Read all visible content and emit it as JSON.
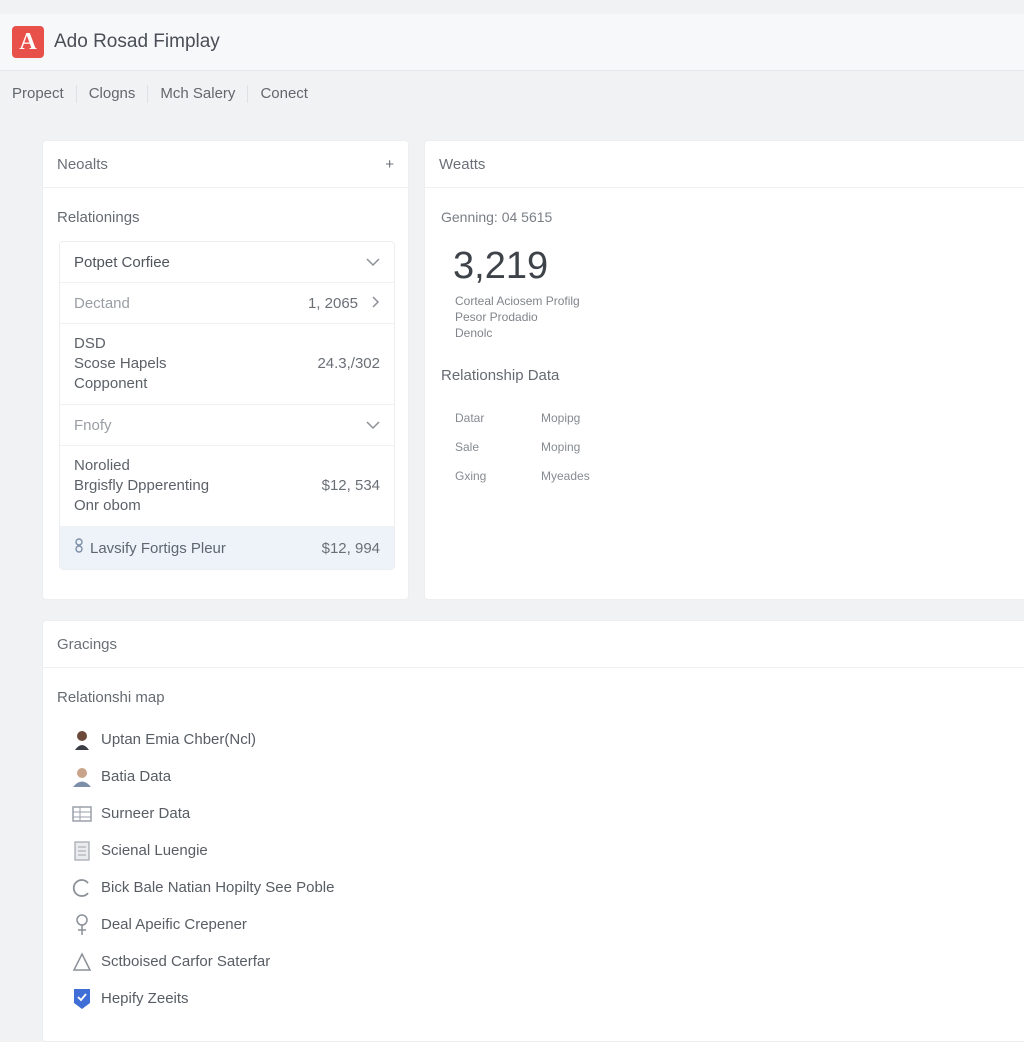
{
  "app": {
    "title": "Ado Rosad Fimplay",
    "logo_letter": "A"
  },
  "menu": [
    "Propect",
    "Clogns",
    "Mch Salery",
    "Conect"
  ],
  "left_panel": {
    "header": "Neoalts",
    "add_symbol": "+",
    "section_title": "Relationings",
    "select_value": "Potpet Corfiee",
    "rows": [
      {
        "label": "Dectand",
        "value": "1, 2065"
      },
      {
        "label_lines": [
          "DSD",
          "Scose Hapels",
          "Copponent"
        ],
        "value": "24.3,/302"
      },
      {
        "label": "Fnofy"
      },
      {
        "label_lines": [
          "Norolied",
          "Brgisfly Dpperenting",
          "Onr obom"
        ],
        "value": "$12, 534"
      },
      {
        "label": "Lavsify Fortigs Pleur",
        "value": "$12, 994"
      }
    ]
  },
  "right_panel": {
    "header": "Weatts",
    "gain_label": "Genning: 04 5615",
    "big_number": "3,219",
    "desc_lines": [
      "Corteal Aciosem Profilg",
      "Pesor Prodadio",
      "Denolc"
    ],
    "relationship_title": "Relationship Data",
    "table": [
      {
        "a": "Datar",
        "b": "Mopipg"
      },
      {
        "a": "Sale",
        "b": "Moping"
      },
      {
        "a": "Gxing",
        "b": "Myeades"
      }
    ]
  },
  "bottom_panel": {
    "header": "Gracings",
    "section_title": "Relationshi map",
    "items": [
      {
        "icon": "person-icon",
        "label": "Uptan Emia Chber(Ncl)"
      },
      {
        "icon": "user-icon",
        "label": "Batia Data"
      },
      {
        "icon": "grid-icon",
        "label": "Surneer Data"
      },
      {
        "icon": "document-icon",
        "label": "Scienal Luengie"
      },
      {
        "icon": "refresh-icon",
        "label": "Bick Bale Natian Hopilty See Poble"
      },
      {
        "icon": "pin-icon",
        "label": "Deal Apeific Crepener"
      },
      {
        "icon": "shape-icon",
        "label": "Sctboised Carfor Saterfar"
      },
      {
        "icon": "badge-icon",
        "label": "Hepify Zeeits"
      }
    ]
  },
  "colors": {
    "accent": "#e8514a",
    "highlight": "#eef3f9",
    "badge": "#3f6fd6"
  }
}
